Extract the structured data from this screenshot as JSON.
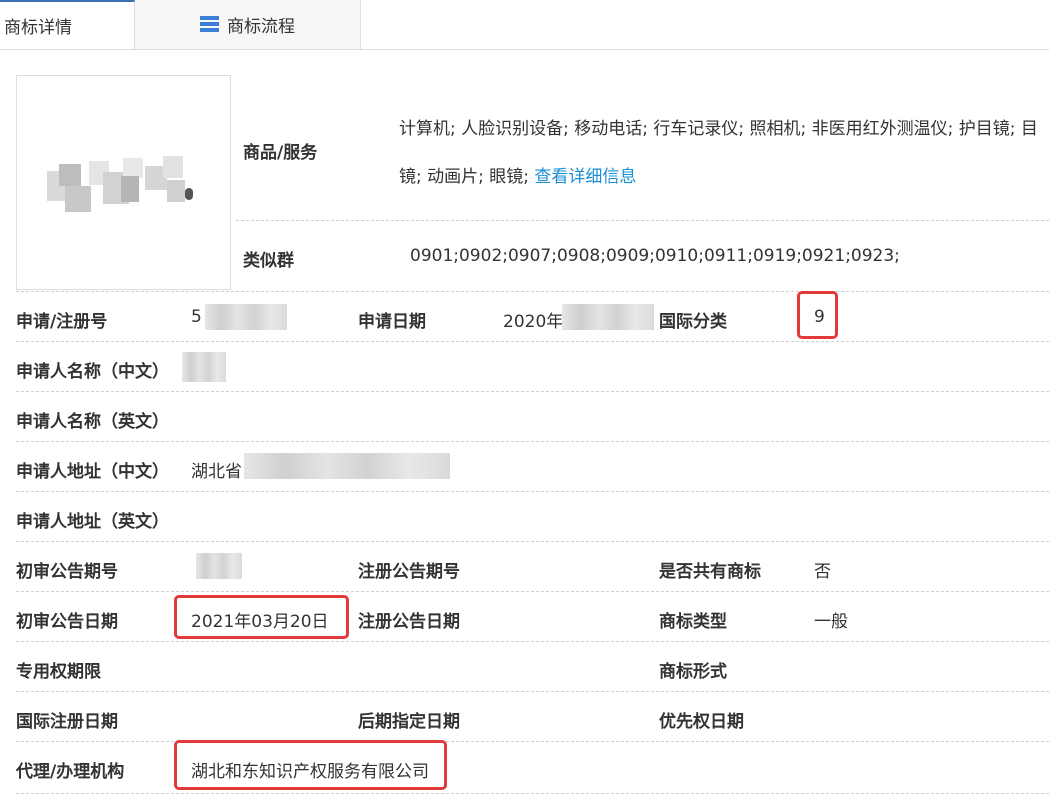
{
  "tabs": [
    {
      "label": "商标详情",
      "active": true
    },
    {
      "label": "商标流程",
      "icon": "list-icon"
    }
  ],
  "goods": {
    "label": "商品/服务",
    "line1": "计算机; 人脸识别设备; 移动电话; 行车记录仪; 照相机; 非医用红外测温仪; 护目镜; 目",
    "line2": "镜; 动画片; 眼镜;",
    "link": "查看详细信息"
  },
  "similar": {
    "label": "类似群",
    "value": "0901;0902;0907;0908;0909;0910;0911;0919;0921;0923;"
  },
  "rows": {
    "reg_no": {
      "label": "申请/注册号",
      "value": "5"
    },
    "apply_date": {
      "label": "申请日期",
      "value": "2020年"
    },
    "intl_class": {
      "label": "国际分类",
      "value": "9"
    },
    "applicant_cn": {
      "label": "申请人名称（中文）",
      "value": ""
    },
    "applicant_en": {
      "label": "申请人名称（英文）",
      "value": ""
    },
    "address_cn": {
      "label": "申请人地址（中文）",
      "value": "湖北省"
    },
    "address_en": {
      "label": "申请人地址（英文）",
      "value": ""
    },
    "prelim_no": {
      "label": "初审公告期号",
      "value": ""
    },
    "reg_pub_no": {
      "label": "注册公告期号",
      "value": ""
    },
    "shared": {
      "label": "是否共有商标",
      "value": "否"
    },
    "prelim_date": {
      "label": "初审公告日期",
      "value": "2021年03月20日"
    },
    "reg_pub_date": {
      "label": "注册公告日期",
      "value": ""
    },
    "tm_type": {
      "label": "商标类型",
      "value": "一般"
    },
    "exclusive": {
      "label": "专用权期限",
      "value": ""
    },
    "tm_form": {
      "label": "商标形式",
      "value": ""
    },
    "intl_reg_date": {
      "label": "国际注册日期",
      "value": ""
    },
    "later_date": {
      "label": "后期指定日期",
      "value": ""
    },
    "priority_date": {
      "label": "优先权日期",
      "value": ""
    },
    "agent": {
      "label": "代理/办理机构",
      "value": "湖北和东知识产权服务有限公司"
    }
  },
  "colors": {
    "accent": "#3b6fb6",
    "link": "#1a8fd6",
    "highlight": "#e23a3a"
  }
}
